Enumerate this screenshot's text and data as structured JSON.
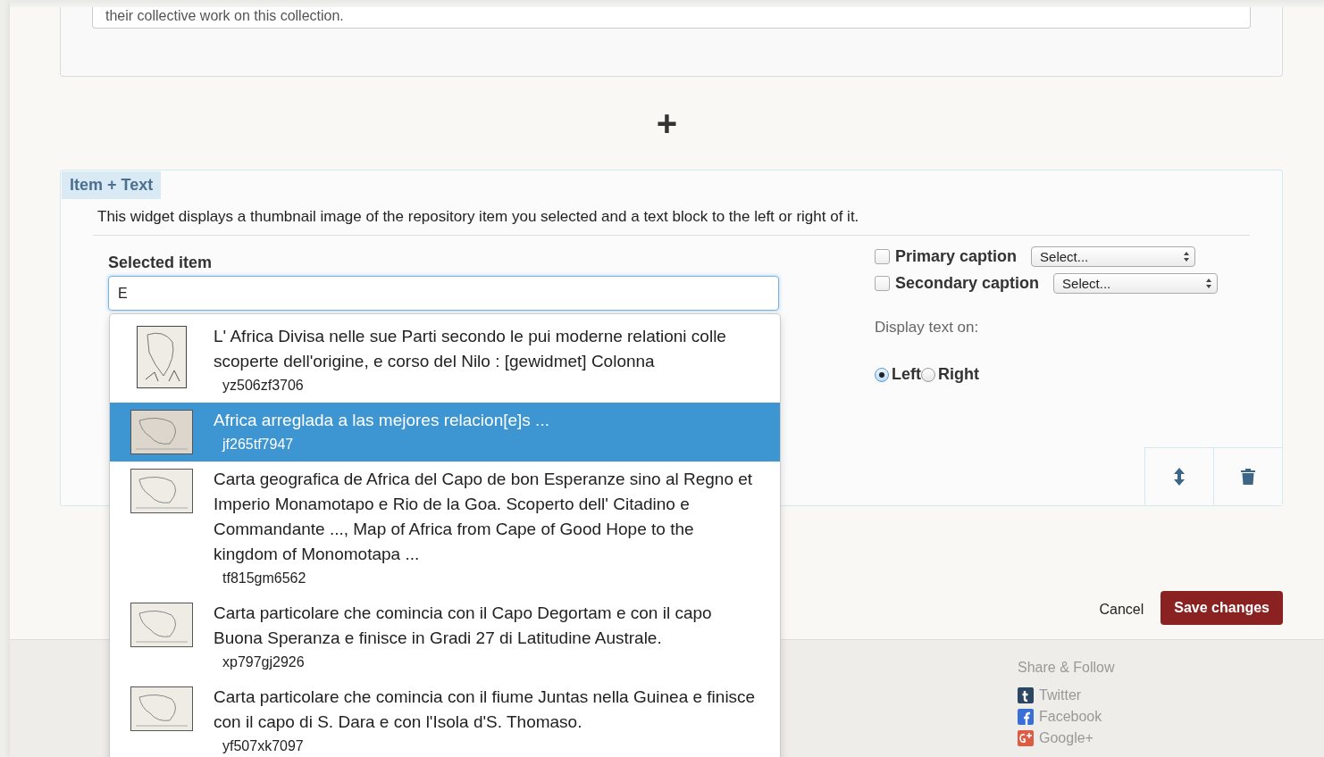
{
  "top_card": {
    "text": "their collective work on this collection."
  },
  "add_button": {
    "label": "+"
  },
  "widget": {
    "title": "Item + Text",
    "description": "This widget displays a thumbnail image of the repository item you selected and a text block to the left or right of it.",
    "selected_item": {
      "label": "Selected item",
      "value": "E"
    },
    "suggestions": [
      {
        "title": "L' Africa Divisa nelle sue Parti secondo le pui moderne relationi colle scoperte dell'origine, e corso del Nilo : [gewidmet] Colonna",
        "id": "yz506zf3706",
        "selected": false,
        "kind": "portrait"
      },
      {
        "title": "Africa arreglada a las mejores relacion[e]s ...",
        "id": "jf265tf7947",
        "selected": true,
        "kind": "landscape"
      },
      {
        "title": "Carta geografica de Africa del Capo de bon Esperanze sino al Regno et Imperio Monamotapo e Rio de la Goa. Scoperto dell' Citadino e Commandante ..., Map of Africa from Cape of Good Hope to the kingdom of Monomotapa ...",
        "id": "tf815gm6562",
        "selected": false,
        "kind": "landscape"
      },
      {
        "title": "Carta particolare che comincia con il Capo Degortam e con il capo Buona Speranza e finisce in Gradi 27 di Latitudine Australe.",
        "id": "xp797gj2926",
        "selected": false,
        "kind": "landscape"
      },
      {
        "title": "Carta particolare che comincia con il fiume Juntas nella Guinea e finisce con il capo di S. Dara e con l'Isola d'S. Thomaso.",
        "id": "yf507xk7097",
        "selected": false,
        "kind": "landscape"
      }
    ],
    "captions": [
      {
        "label": "Primary caption",
        "checked": false,
        "select": "Select..."
      },
      {
        "label": "Secondary caption",
        "checked": false,
        "select": "Select..."
      }
    ],
    "display_label": "Display text on:",
    "display_options": [
      {
        "label": "Left",
        "selected": true
      },
      {
        "label": "Right",
        "selected": false
      }
    ]
  },
  "actions": {
    "cancel": "Cancel",
    "save": "Save changes"
  },
  "footer": {
    "heading": "Share & Follow",
    "links": [
      {
        "label": "Twitter",
        "kind": "tumblr"
      },
      {
        "label": "Facebook",
        "kind": "facebook"
      },
      {
        "label": "Google+",
        "kind": "googleplus"
      }
    ]
  }
}
